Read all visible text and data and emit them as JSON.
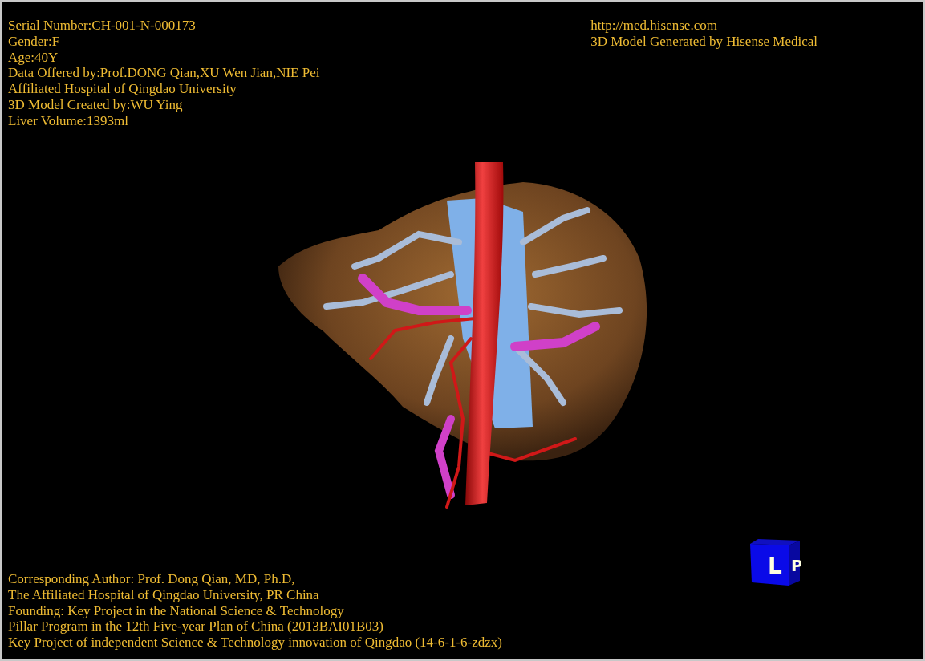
{
  "header_left": [
    "Serial Number:CH-001-N-000173",
    "Gender:F",
    "Age:40Y",
    "Data Offered by:Prof.DONG Qian,XU Wen Jian,NIE Pei",
    "Affiliated Hospital of Qingdao University",
    "3D Model Created by:WU Ying",
    "Liver Volume:1393ml"
  ],
  "header_right": [
    "http://med.hisense.com",
    "3D Model Generated by Hisense Medical"
  ],
  "footer": [
    "Corresponding Author: Prof. Dong Qian, MD, Ph.D,",
    "The Affiliated Hospital of Qingdao University, PR China",
    "Founding: Key Project in the National Science & Technology",
    "Pillar Program in the 12th Five-year Plan of China (2013BAI01B03)",
    "Key Project of independent Science & Technology innovation of Qingdao (14-6-1-6-zdzx)"
  ],
  "orientation_cube": {
    "faces": [
      "L",
      "P"
    ]
  }
}
